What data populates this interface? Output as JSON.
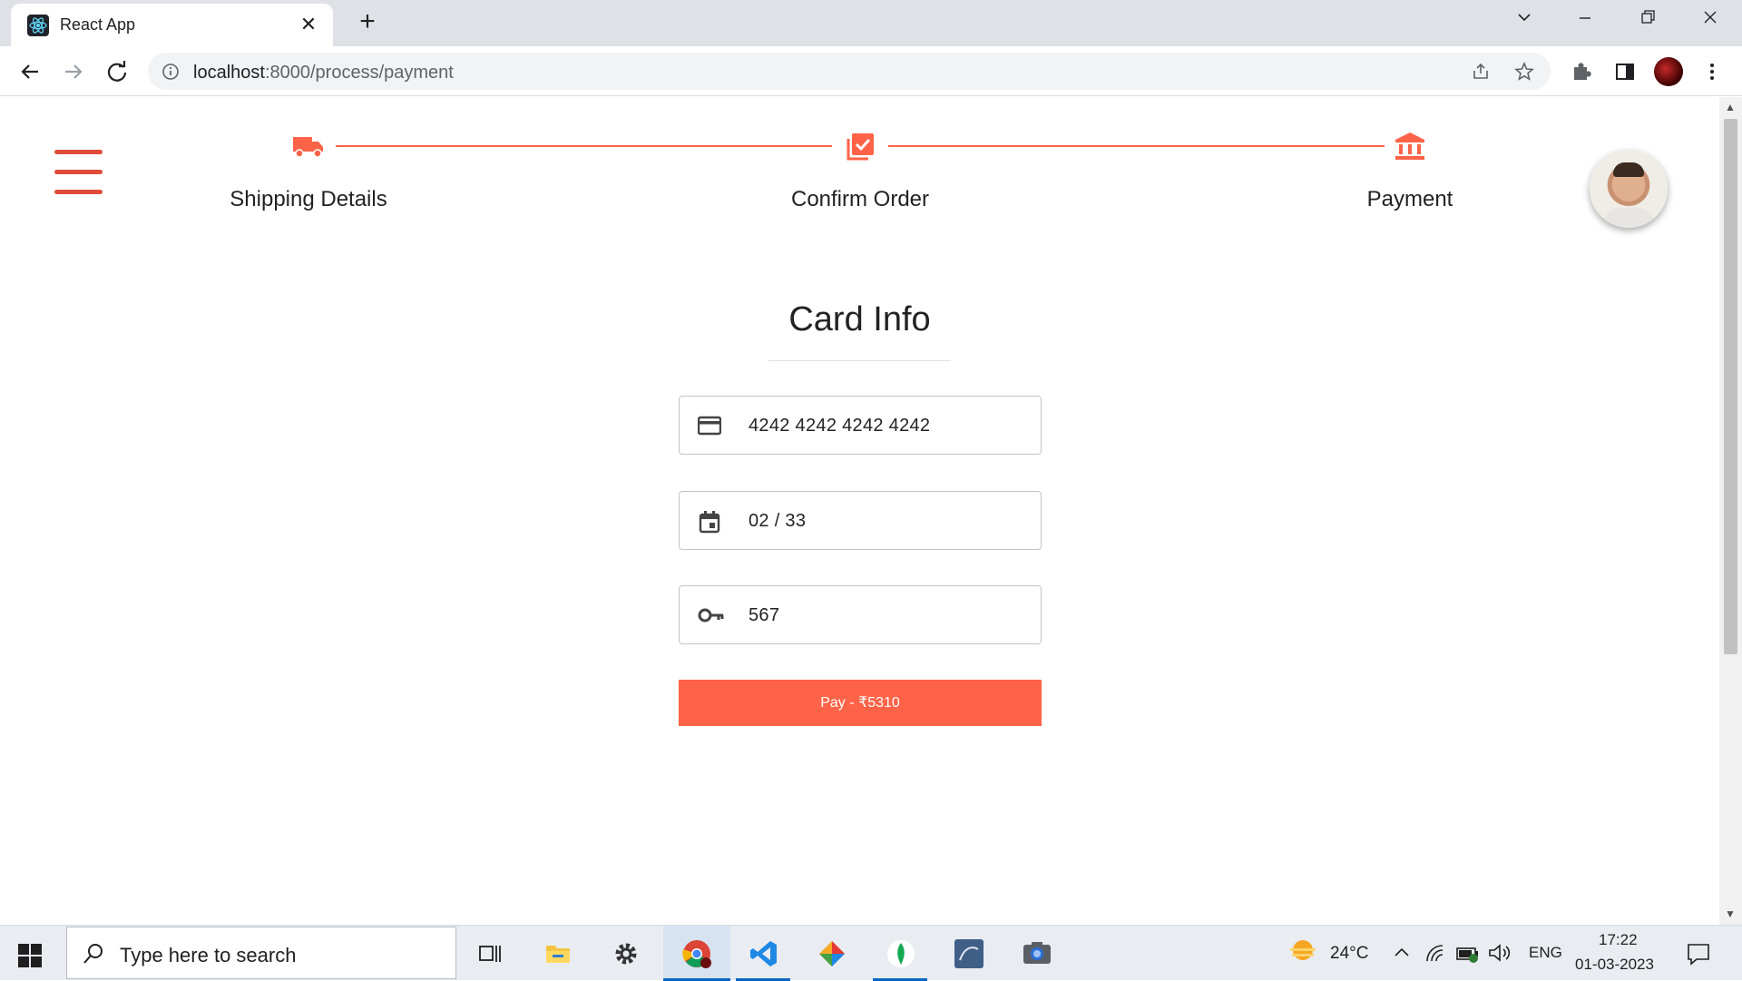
{
  "browser": {
    "tab_title": "React App",
    "url_host": "localhost",
    "url_path": ":8000/process/payment"
  },
  "stepper": {
    "steps": [
      {
        "label": "Shipping Details",
        "icon": "truck-icon"
      },
      {
        "label": "Confirm Order",
        "icon": "checklist-icon"
      },
      {
        "label": "Payment",
        "icon": "bank-icon"
      }
    ],
    "active_step": 3,
    "accent_color": "#ff6347"
  },
  "payment_form": {
    "title": "Card Info",
    "card_number": "4242 4242 4242 4242",
    "expiry": "02 / 33",
    "cvc": "567",
    "pay_label": "Pay - ₹5310"
  },
  "taskbar": {
    "search_placeholder": "Type here to search",
    "weather": "24°C",
    "language": "ENG",
    "time": "17:22",
    "date": "01-03-2023"
  }
}
